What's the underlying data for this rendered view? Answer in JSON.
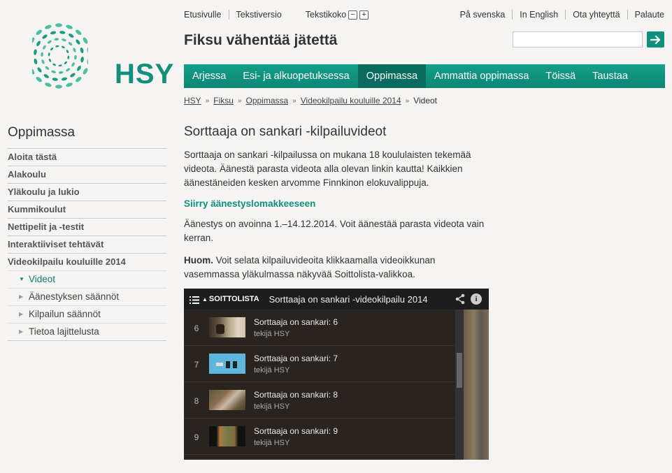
{
  "logo": {
    "text": "HSY",
    "color": "#128f7c"
  },
  "top_links": {
    "home": "Etusivulle",
    "text_version": "Tekstiversio",
    "text_size": "Tekstikoko",
    "decrease": "−",
    "increase": "+"
  },
  "lang_links": [
    "På svenska",
    "In English",
    "Ota yhteyttä",
    "Palaute"
  ],
  "site_title": "Fiksu vähentää jätettä",
  "search": {
    "value": "",
    "button_icon": "arrow-right-icon"
  },
  "nav": {
    "items": [
      {
        "label": "Arjessa",
        "active": false
      },
      {
        "label": "Esi- ja alkuopetuksessa",
        "active": false
      },
      {
        "label": "Oppimassa",
        "active": true
      },
      {
        "label": "Ammattia oppimassa",
        "active": false
      },
      {
        "label": "Töissä",
        "active": false
      },
      {
        "label": "Taustaa",
        "active": false
      }
    ]
  },
  "breadcrumb": [
    "HSY",
    "Fiksu",
    "Oppimassa",
    "Videokilpailu kouluille 2014",
    "Videot"
  ],
  "sidebar": {
    "title": "Oppimassa",
    "items": [
      "Aloita tästä",
      "Alakoulu",
      "Yläkoulu ja lukio",
      "Kummikoulut",
      "Nettipelit ja -testit",
      "Interaktiiviset tehtävät",
      "Videokilpailu kouluille 2014"
    ],
    "subitems": [
      {
        "label": "Videot",
        "active": true
      },
      {
        "label": "Äänestyksen säännöt",
        "active": false
      },
      {
        "label": "Kilpailun säännöt",
        "active": false
      },
      {
        "label": "Tietoa lajittelusta",
        "active": false
      }
    ]
  },
  "main": {
    "title": "Sorttaaja on sankari -kilpailuvideot",
    "intro": "Sorttaaja on sankari -kilpailussa on mukana 18 koululaisten tekemää videota. Äänestä parasta videota alla olevan linkin kautta! Kaikkien äänestäneiden kesken arvomme Finnkinon elokuvalippuja.",
    "vote_link": "Siirry äänestyslomakkeeseen",
    "voting_period": "Äänestys on avoinna 1.–14.12.2014. Voit äänestää parasta videota vain kerran.",
    "note_bold": "Huom.",
    "note_text": " Voit selata kilpailuvideoita klikkaamalla videoikkunan vasemmassa yläkulmassa näkyvää Soittolista-valikkoa."
  },
  "player": {
    "playlist_label": "SOITTOLISTA",
    "title": "Sorttaaja on sankari -videokilpailu 2014",
    "share_icon": "share-icon",
    "info_icon": "info-icon",
    "info_glyph": "i",
    "rows": [
      {
        "num": "6",
        "title": "Sorttaaja on sankari: 6",
        "author": "tekijä HSY"
      },
      {
        "num": "7",
        "title": "Sorttaaja on sankari: 7",
        "author": "tekijä HSY"
      },
      {
        "num": "8",
        "title": "Sorttaaja on sankari: 8",
        "author": "tekijä HSY"
      },
      {
        "num": "9",
        "title": "Sorttaaja on sankari: 9",
        "author": "tekijä HSY"
      }
    ]
  }
}
